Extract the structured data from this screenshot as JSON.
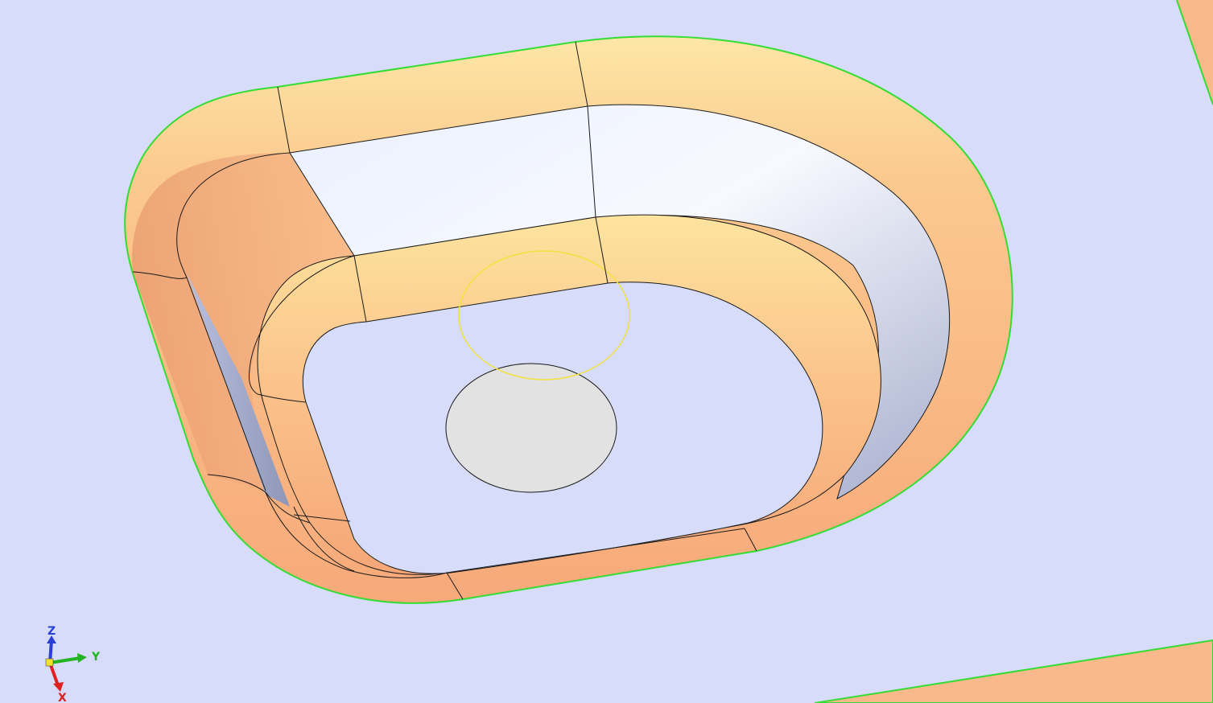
{
  "viewport": {
    "background_color": "#d6dcf9",
    "face_color_orange": "#f9b98a",
    "face_color_highlight": "#fce3a0",
    "edge_color": "#1a1a1a",
    "outer_boundary_color": "#33dd33",
    "selection_color": "#f2e23c",
    "hole_color": "#e2e2e2"
  },
  "triad": {
    "z_label": "Z",
    "y_label": "Y",
    "x_label": "X",
    "z_color": "#2a3fd6",
    "y_color": "#22b422",
    "x_color": "#e02020",
    "origin_color": "#f0e030"
  },
  "icons": [
    "axis-triad-icon"
  ]
}
